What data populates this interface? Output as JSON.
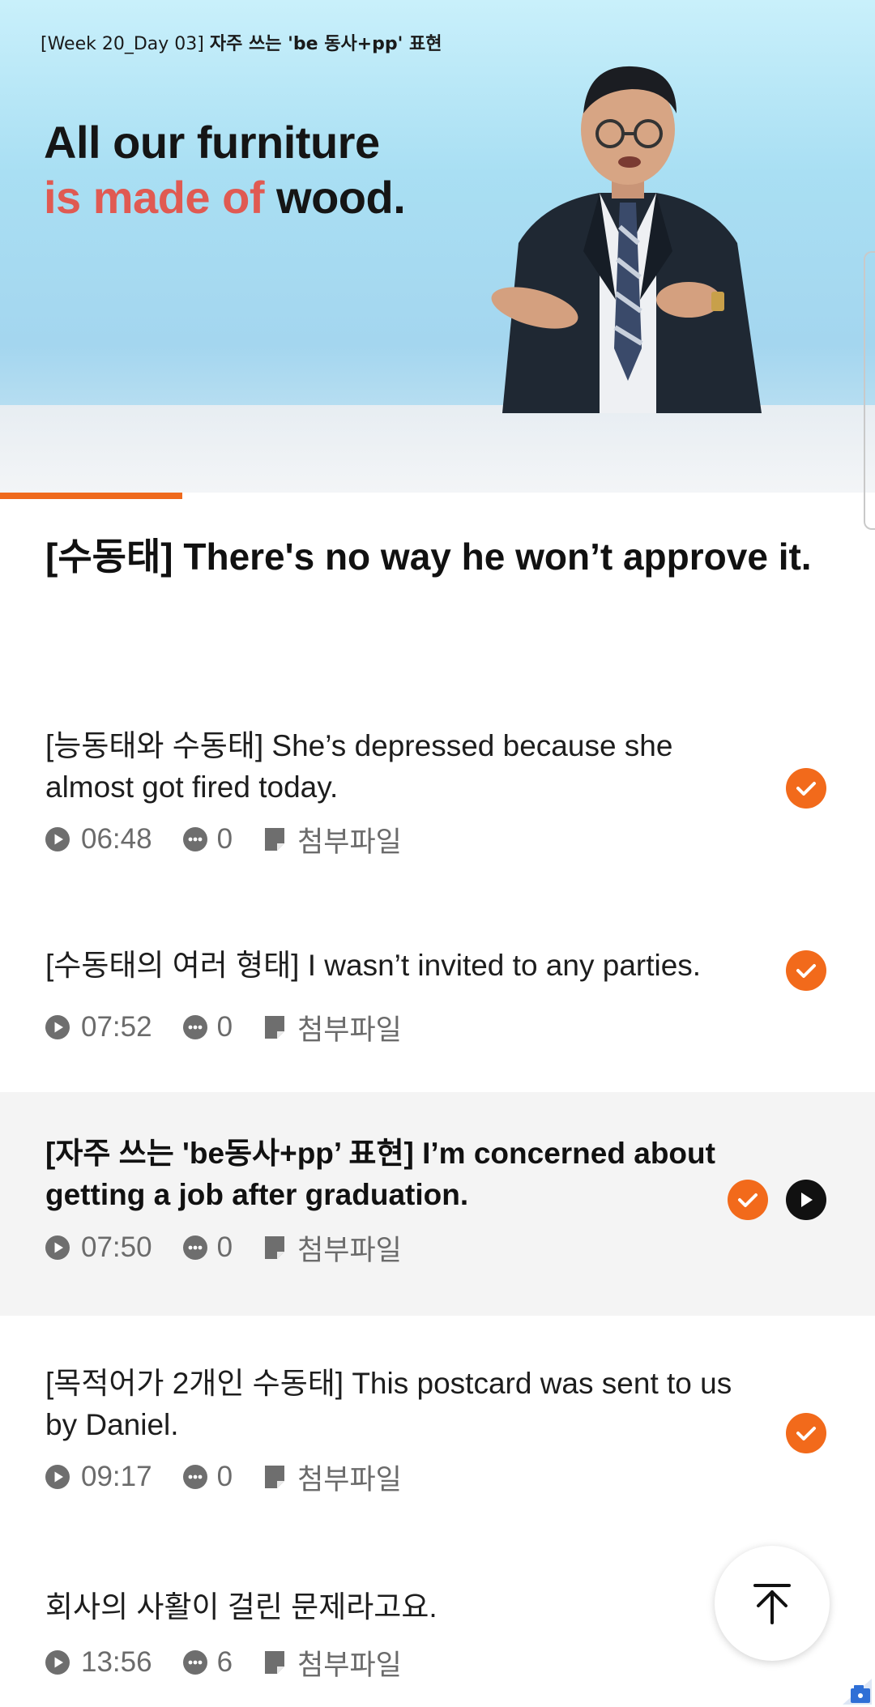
{
  "video": {
    "caption_prefix": "[Week 20_Day 03]",
    "caption_main": "자주 쓰는 'be 동사+pp' 표현",
    "slide_line1": "All our furniture",
    "slide_line2_red": "is made of",
    "slide_line2_rest": "wood.",
    "progress_fraction": 0.208
  },
  "lesson": {
    "title": "[수동태] There's no way he won’t approve it."
  },
  "attach_label": "첨부파일",
  "items": [
    {
      "title": "[능동태와 수동태] She’s depressed because she almost got fired today.",
      "duration": "06:48",
      "comments": "0",
      "completed": true
    },
    {
      "title": "[수동태의 여러 형태] I wasn’t invited to any parties.",
      "duration": "07:52",
      "comments": "0",
      "completed": true
    },
    {
      "title": "[자주 쓰는 'be동사+pp’ 표현] I’m concerned about getting a job after graduation.",
      "duration": "07:50",
      "comments": "0",
      "completed": true,
      "playing": true
    },
    {
      "title": "[목적어가 2개인 수동태] This postcard was sent to us by Daniel.",
      "duration": "09:17",
      "comments": "0",
      "completed": true
    },
    {
      "title": "회사의 사활이 걸린 문제라고요.",
      "duration": "13:56",
      "comments": "6",
      "completed": false
    }
  ],
  "colors": {
    "accent": "#f26a1b",
    "active_row": "#f4f4f4",
    "meta_text": "#6b6b6b"
  },
  "icons": {
    "duration": "play-circle-icon",
    "comments": "chat-bubble-icon",
    "attachment": "file-icon",
    "completed": "check-circle-icon",
    "now_playing": "play-button-icon",
    "scroll_top": "arrow-up-to-line-icon"
  }
}
